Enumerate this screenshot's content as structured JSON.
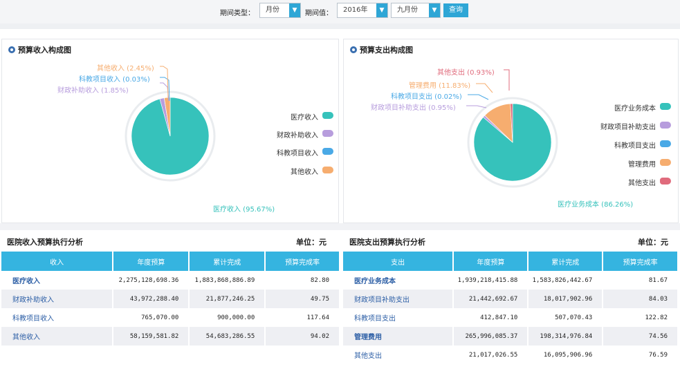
{
  "filter": {
    "period_type_label": "期间类型：",
    "period_type_value": "月份",
    "period_value_label": "期间值：",
    "year_value": "2016年",
    "month_value": "九月份",
    "query_button": "查询",
    "dropdown_icon": "chevron-down-icon"
  },
  "income_chart": {
    "title": "预算收入构成图",
    "labels": {
      "medical": "医疗收入 (95.67%)",
      "fiscal": "财政补助收入 (1.85%)",
      "research": "科教项目收入 (0.03%)",
      "other": "其他收入 (2.45%)"
    },
    "legend": [
      "医疗收入",
      "财政补助收入",
      "科教项目收入",
      "其他收入"
    ]
  },
  "expense_chart": {
    "title": "预算支出构成图",
    "labels": {
      "medical_cost": "医疗业务成本 (86.26%)",
      "fiscal": "财政项目补助支出 (0.95%)",
      "research": "科教项目支出 (0.02%)",
      "admin": "管理费用 (11.83%)",
      "other": "其他支出 (0.93%)"
    },
    "legend": [
      "医疗业务成本",
      "财政项目补助支出",
      "科教项目支出",
      "管理费用",
      "其他支出"
    ]
  },
  "chart_data": [
    {
      "type": "pie",
      "title": "预算收入构成图",
      "categories": [
        "医疗收入",
        "财政补助收入",
        "科教项目收入",
        "其他收入"
      ],
      "values": [
        95.67,
        1.85,
        0.03,
        2.45
      ],
      "colors": [
        "#36c2bb",
        "#b79ddd",
        "#4aa9e6",
        "#f6ad6f"
      ],
      "legend": "right"
    },
    {
      "type": "pie",
      "title": "预算支出构成图",
      "categories": [
        "医疗业务成本",
        "财政项目补助支出",
        "科教项目支出",
        "管理费用",
        "其他支出"
      ],
      "values": [
        86.26,
        0.95,
        0.02,
        11.83,
        0.93
      ],
      "colors": [
        "#36c2bb",
        "#b79ddd",
        "#4aa9e6",
        "#f6ad6f",
        "#e06b7c"
      ],
      "legend": "right"
    }
  ],
  "income_table": {
    "title": "医院收入预算执行分析",
    "unit": "单位：元",
    "headers": [
      "收入",
      "年度预算",
      "累计完成",
      "预算完成率"
    ],
    "rows": [
      [
        "医疗收入",
        "2,275,128,698.36",
        "1,883,868,886.89",
        "82.80"
      ],
      [
        "财政补助收入",
        "43,972,288.40",
        "21,877,246.25",
        "49.75"
      ],
      [
        "科教项目收入",
        "765,070.00",
        "900,000.00",
        "117.64"
      ],
      [
        "其他收入",
        "58,159,581.82",
        "54,683,286.55",
        "94.02"
      ]
    ]
  },
  "expense_table": {
    "title": "医院支出预算执行分析",
    "unit": "单位：元",
    "headers": [
      "支出",
      "年度预算",
      "累计完成",
      "预算完成率"
    ],
    "rows": [
      [
        "医疗业务成本",
        "1,939,218,415.88",
        "1,583,826,442.67",
        "81.67"
      ],
      [
        "财政项目补助支出",
        "21,442,692.67",
        "18,017,902.96",
        "84.03"
      ],
      [
        "科教项目支出",
        "412,847.10",
        "507,070.43",
        "122.82"
      ],
      [
        "管理费用",
        "265,996,085.37",
        "198,314,976.84",
        "74.56"
      ],
      [
        "其他支出",
        "21,017,026.55",
        "16,095,906.96",
        "76.59"
      ]
    ]
  }
}
